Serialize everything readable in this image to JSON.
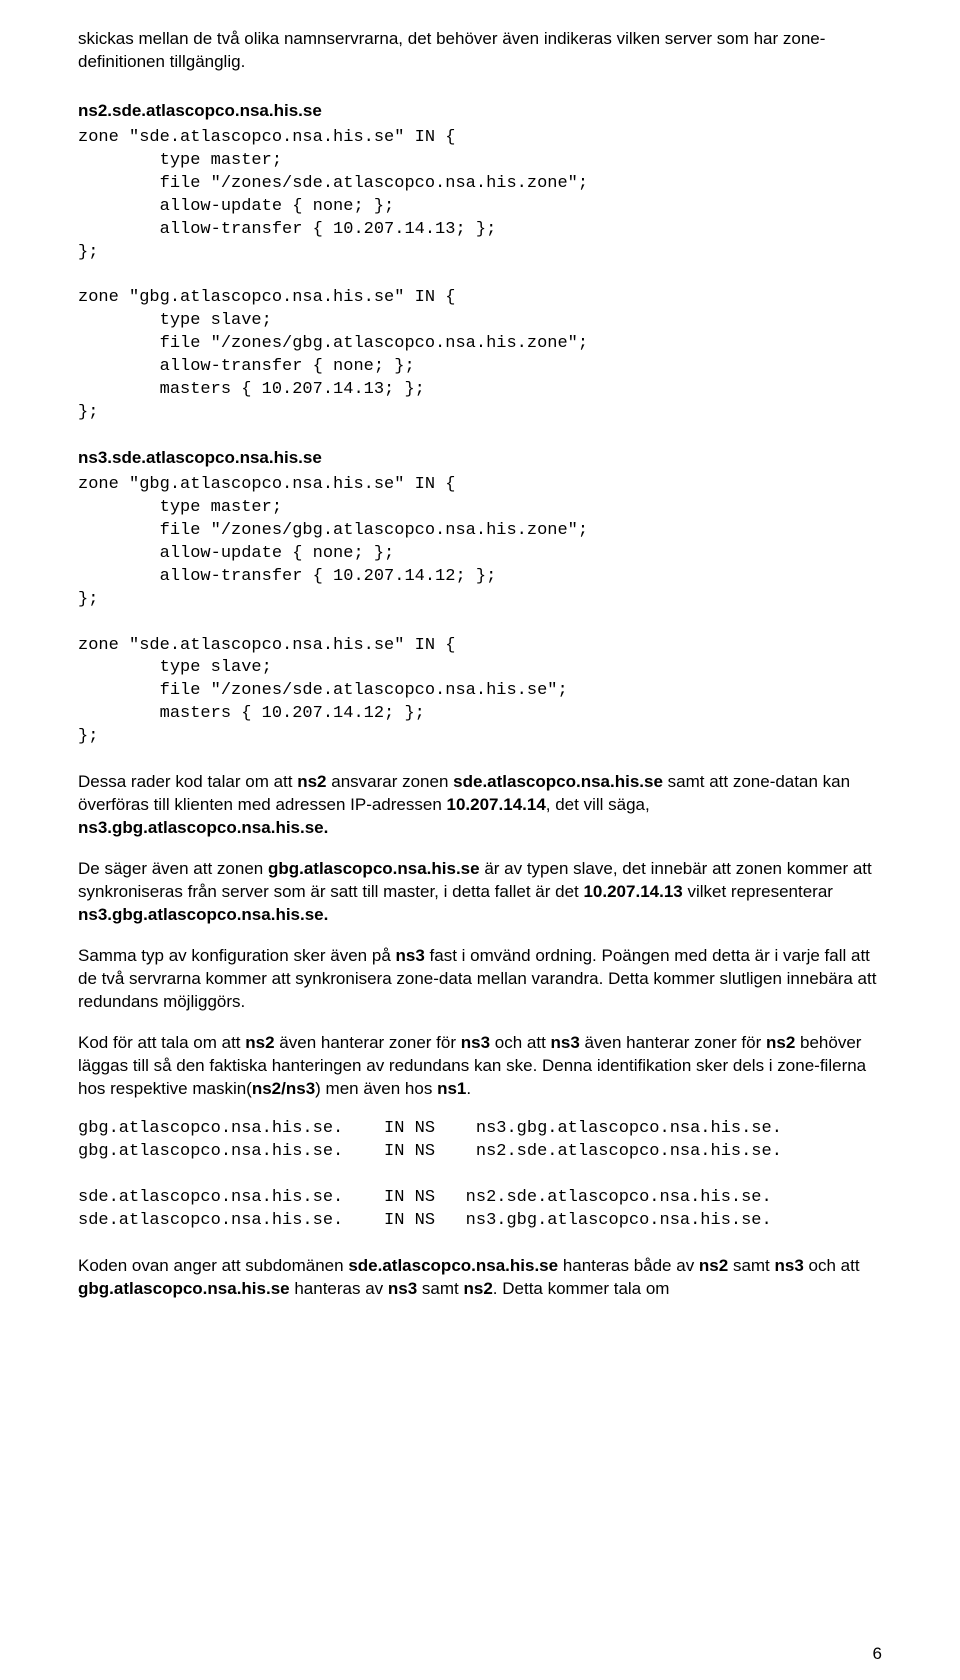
{
  "p1": "skickas mellan de två olika namnservrarna, det behöver även indikeras vilken server som har zone-definitionen tillgänglig.",
  "h1": "ns2.sde.atlascopco.nsa.his.se",
  "code1": "zone \"sde.atlascopco.nsa.his.se\" IN {\n        type master;\n        file \"/zones/sde.atlascopco.nsa.his.zone\";\n        allow-update { none; };\n        allow-transfer { 10.207.14.13; };\n};\n\nzone \"gbg.atlascopco.nsa.his.se\" IN {\n        type slave;\n        file \"/zones/gbg.atlascopco.nsa.his.zone\";\n        allow-transfer { none; };\n        masters { 10.207.14.13; };\n};",
  "h2": "ns3.sde.atlascopco.nsa.his.se",
  "code2": "zone \"gbg.atlascopco.nsa.his.se\" IN {\n        type master;\n        file \"/zones/gbg.atlascopco.nsa.his.zone\";\n        allow-update { none; };\n        allow-transfer { 10.207.14.12; };\n};\n\nzone \"sde.atlascopco.nsa.his.se\" IN {\n        type slave;\n        file \"/zones/sde.atlascopco.nsa.his.se\";\n        masters { 10.207.14.12; };\n};",
  "p2a": "Dessa rader kod talar om att ",
  "p2b": "ns2",
  "p2c": " ansvarar zonen ",
  "p2d": "sde.atlascopco.nsa.his.se",
  "p2e": " samt att zone-datan kan överföras till klienten med adressen IP-adressen ",
  "p2f": "10.207.14.14",
  "p2g": ", det vill säga, ",
  "p2h": "ns3.gbg.atlascopco.nsa.his.se.",
  "p3a": "De säger även att zonen ",
  "p3b": "gbg.atlascopco.nsa.his.se",
  "p3c": " är av typen slave, det innebär att zonen kommer att synkroniseras från server som är satt till master, i detta fallet är det ",
  "p3d": "10.207.14.13",
  "p3e": " vilket representerar ",
  "p3f": "ns3.gbg.atlascopco.nsa.his.se.",
  "p4a": "Samma typ av konfiguration sker även på ",
  "p4b": "ns3",
  "p4c": " fast i omvänd ordning. Poängen med detta är i varje fall att de två servrarna kommer att synkronisera zone-data mellan varandra. Detta kommer slutligen innebära att redundans möjliggörs.",
  "p5a": "Kod för att tala om att ",
  "p5b": "ns2",
  "p5c": " även hanterar zoner för ",
  "p5d": "ns3",
  "p5e": " och att ",
  "p5f": "ns3",
  "p5g": " även hanterar zoner för ",
  "p5h": "ns2",
  "p5i": " behöver läggas till så den faktiska hanteringen av redundans kan ske. Denna identifikation sker dels i zone-filerna hos respektive maskin(",
  "p5j": "ns2/ns3",
  "p5k": ") men även hos ",
  "p5l": "ns1",
  "p5m": ".",
  "code3": "gbg.atlascopco.nsa.his.se.    IN NS    ns3.gbg.atlascopco.nsa.his.se.\ngbg.atlascopco.nsa.his.se.    IN NS    ns2.sde.atlascopco.nsa.his.se.\n\nsde.atlascopco.nsa.his.se.    IN NS   ns2.sde.atlascopco.nsa.his.se.\nsde.atlascopco.nsa.his.se.    IN NS   ns3.gbg.atlascopco.nsa.his.se.",
  "p6a": "Koden ovan anger att subdomänen ",
  "p6b": "sde.atlascopco.nsa.his.se",
  "p6c": " hanteras både av ",
  "p6d": "ns2",
  "p6e": " samt ",
  "p6f": "ns3",
  "p6g": " och att ",
  "p6h": "gbg.atlascopco.nsa.his.se",
  "p6i": " hanteras av ",
  "p6j": "ns3",
  "p6k": " samt ",
  "p6l": "ns2",
  "p6m": ". Detta kommer tala om",
  "pageNum": "6"
}
